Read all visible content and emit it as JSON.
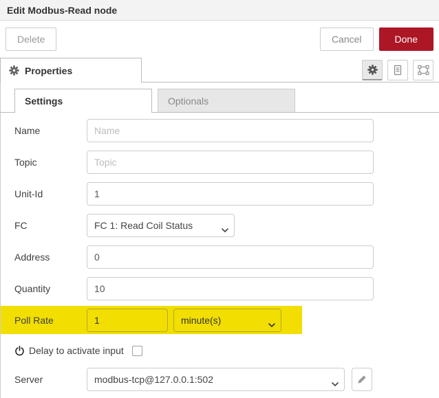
{
  "header": {
    "title": "Edit Modbus-Read node"
  },
  "toolbar": {
    "delete_label": "Delete",
    "cancel_label": "Cancel",
    "done_label": "Done"
  },
  "tray": {
    "properties_tab_label": "Properties",
    "icon_buttons": [
      "gear-icon",
      "document-icon",
      "appearance-frame-icon"
    ]
  },
  "tabs": [
    {
      "label": "Settings",
      "active": true
    },
    {
      "label": "Optionals",
      "active": false
    }
  ],
  "form": {
    "name": {
      "label": "Name",
      "value": "",
      "placeholder": "Name"
    },
    "topic": {
      "label": "Topic",
      "value": "",
      "placeholder": "Topic"
    },
    "unit_id": {
      "label": "Unit-Id",
      "value": "1"
    },
    "fc": {
      "label": "FC",
      "value": "FC 1: Read Coil Status"
    },
    "address": {
      "label": "Address",
      "value": "0"
    },
    "quantity": {
      "label": "Quantity",
      "value": "10"
    },
    "poll_rate": {
      "label": "Poll Rate",
      "value": "1",
      "unit": "minute(s)"
    },
    "delay": {
      "label": "Delay to activate input",
      "checked": false
    },
    "server": {
      "label": "Server",
      "value": "modbus-tcp@127.0.0.1:502"
    }
  },
  "icons": {
    "power": "power-icon",
    "pencil": "edit-pencil-icon",
    "chevron": "chevron-down-icon"
  },
  "colors": {
    "accent_red": "#AD1625",
    "highlight_yellow": "#f2de00",
    "header_bg": "#f3f3f3",
    "inactive_tab_bg": "#e7e7e7"
  }
}
